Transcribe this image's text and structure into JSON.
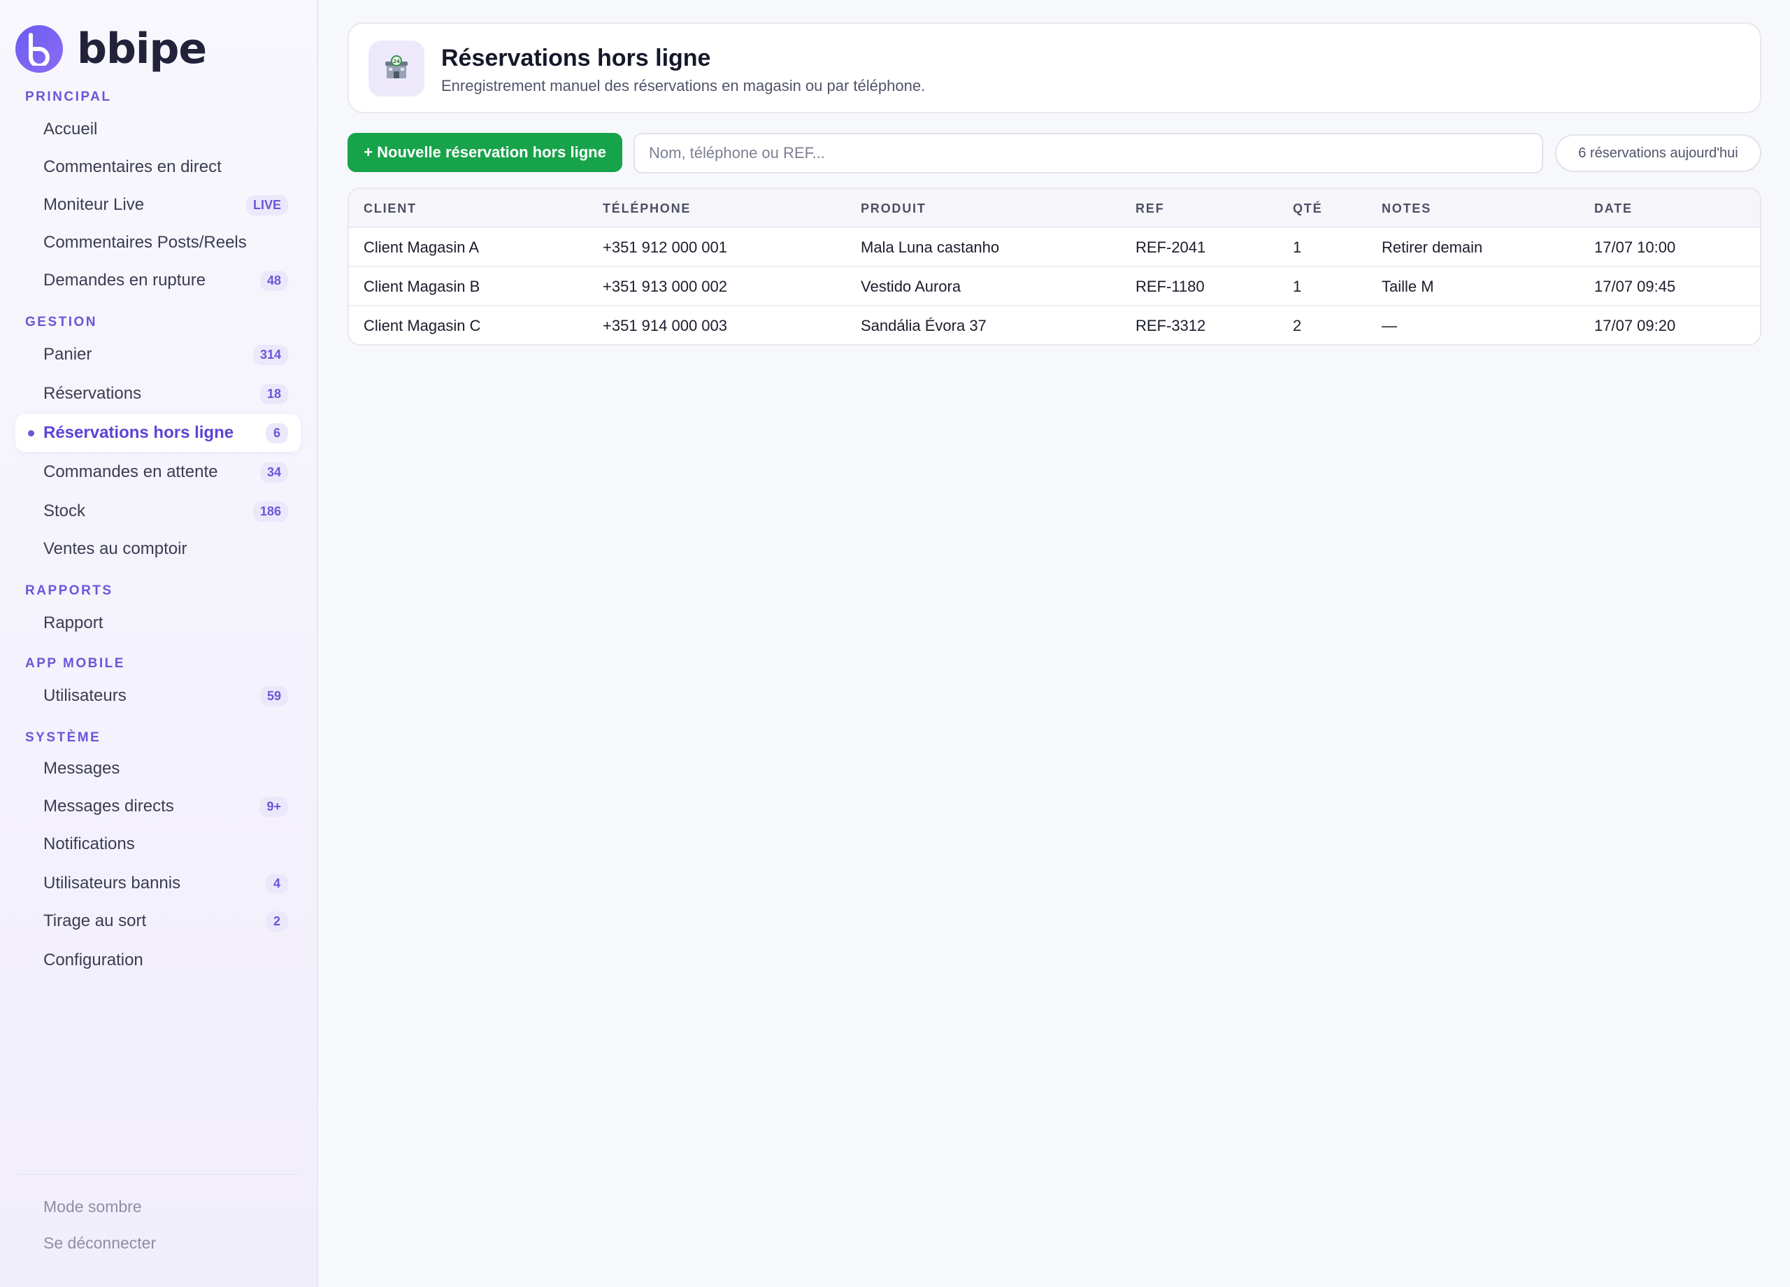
{
  "brand": {
    "name": "bbipe",
    "accent": "#6a56d8"
  },
  "sidebar": {
    "sections": [
      {
        "title": "PRINCIPAL",
        "items": [
          {
            "label": "Accueil",
            "badge": ""
          },
          {
            "label": "Commentaires en direct",
            "badge": ""
          },
          {
            "label": "Moniteur Live",
            "badge": "LIVE"
          },
          {
            "label": "Commentaires Posts/Reels",
            "badge": ""
          },
          {
            "label": "Demandes en rupture",
            "badge": "48"
          }
        ]
      },
      {
        "title": "GESTION",
        "items": [
          {
            "label": "Panier",
            "badge": "314"
          },
          {
            "label": "Réservations",
            "badge": "18"
          },
          {
            "label": "Réservations hors ligne",
            "badge": "6",
            "active": true
          },
          {
            "label": "Commandes en attente",
            "badge": "34"
          },
          {
            "label": "Stock",
            "badge": "186"
          },
          {
            "label": "Ventes au comptoir",
            "badge": ""
          }
        ]
      },
      {
        "title": "RAPPORTS",
        "items": [
          {
            "label": "Rapport",
            "badge": ""
          }
        ]
      },
      {
        "title": "APP MOBILE",
        "items": [
          {
            "label": "Utilisateurs",
            "badge": "59"
          }
        ]
      },
      {
        "title": "SYSTÈME",
        "items": [
          {
            "label": "Messages",
            "badge": ""
          },
          {
            "label": "Messages directs",
            "badge": "9+"
          },
          {
            "label": "Notifications",
            "badge": ""
          },
          {
            "label": "Utilisateurs bannis",
            "badge": "4"
          },
          {
            "label": "Tirage au sort",
            "badge": "2"
          },
          {
            "label": "Configuration",
            "badge": ""
          }
        ]
      }
    ],
    "footer": {
      "dark_mode": "Mode sombre",
      "logout": "Se déconnecter"
    }
  },
  "header": {
    "icon": "store-24h-icon",
    "title": "Réservations hors ligne",
    "subtitle": "Enregistrement manuel des réservations en magasin ou par téléphone."
  },
  "toolbar": {
    "new_button": "+ Nouvelle réservation hors ligne",
    "new_button_color": "#17a34a",
    "search_placeholder": "Nom, téléphone ou REF...",
    "count_label": "6 réservations aujourd'hui"
  },
  "table": {
    "columns": [
      "CLIENT",
      "TÉLÉPHONE",
      "PRODUIT",
      "REF",
      "QTÉ",
      "NOTES",
      "DATE"
    ],
    "rows": [
      [
        "Client Magasin A",
        "+351 912 000 001",
        "Mala Luna castanho",
        "REF-2041",
        "1",
        "Retirer demain",
        "17/07 10:00"
      ],
      [
        "Client Magasin B",
        "+351 913 000 002",
        "Vestido Aurora",
        "REF-1180",
        "1",
        "Taille M",
        "17/07 09:45"
      ],
      [
        "Client Magasin C",
        "+351 914 000 003",
        "Sandália Évora 37",
        "REF-3312",
        "2",
        "—",
        "17/07 09:20"
      ]
    ]
  }
}
